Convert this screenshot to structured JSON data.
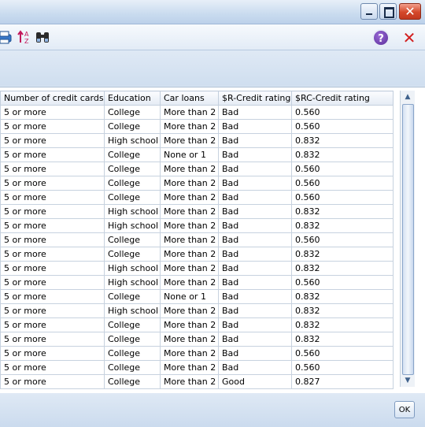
{
  "window": {
    "minimize_label": "_",
    "maximize_label": "□",
    "close_label": "✕"
  },
  "toolbar": {
    "help_label": "?",
    "close_label": "✕"
  },
  "table": {
    "columns": [
      "Number of credit cards",
      "Education",
      "Car loans",
      "$R-Credit rating",
      "$RC-Credit rating"
    ],
    "rows": [
      [
        "5 or more",
        "College",
        "More than 2",
        "Bad",
        "0.560"
      ],
      [
        "5 or more",
        "College",
        "More than 2",
        "Bad",
        "0.560"
      ],
      [
        "5 or more",
        "High school",
        "More than 2",
        "Bad",
        "0.832"
      ],
      [
        "5 or more",
        "College",
        "None or 1",
        "Bad",
        "0.832"
      ],
      [
        "5 or more",
        "College",
        "More than 2",
        "Bad",
        "0.560"
      ],
      [
        "5 or more",
        "College",
        "More than 2",
        "Bad",
        "0.560"
      ],
      [
        "5 or more",
        "College",
        "More than 2",
        "Bad",
        "0.560"
      ],
      [
        "5 or more",
        "High school",
        "More than 2",
        "Bad",
        "0.832"
      ],
      [
        "5 or more",
        "High school",
        "More than 2",
        "Bad",
        "0.832"
      ],
      [
        "5 or more",
        "College",
        "More than 2",
        "Bad",
        "0.560"
      ],
      [
        "5 or more",
        "College",
        "More than 2",
        "Bad",
        "0.832"
      ],
      [
        "5 or more",
        "High school",
        "More than 2",
        "Bad",
        "0.832"
      ],
      [
        "5 or more",
        "High school",
        "More than 2",
        "Bad",
        "0.560"
      ],
      [
        "5 or more",
        "College",
        "None or 1",
        "Bad",
        "0.832"
      ],
      [
        "5 or more",
        "High school",
        "More than 2",
        "Bad",
        "0.832"
      ],
      [
        "5 or more",
        "College",
        "More than 2",
        "Bad",
        "0.832"
      ],
      [
        "5 or more",
        "College",
        "More than 2",
        "Bad",
        "0.832"
      ],
      [
        "5 or more",
        "College",
        "More than 2",
        "Bad",
        "0.560"
      ],
      [
        "5 or more",
        "College",
        "More than 2",
        "Bad",
        "0.560"
      ],
      [
        "5 or more",
        "College",
        "More than 2",
        "Good",
        "0.827"
      ]
    ]
  },
  "scrollbar": {
    "up_label": "▲",
    "down_label": "▼"
  },
  "footer": {
    "ok_label": "OK"
  }
}
